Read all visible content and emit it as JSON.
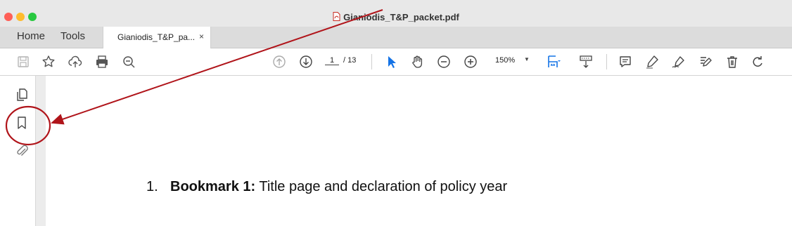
{
  "window": {
    "file_title": "Gianiodis_T&P_packet.pdf",
    "traffic_lights": {
      "close": "#ff5f57",
      "minimize": "#febc2e",
      "zoom": "#28c840"
    }
  },
  "menu": {
    "home_label": "Home",
    "tools_label": "Tools"
  },
  "document_tab": {
    "label": "Gianiodis_T&P_pa...",
    "close_glyph": "×"
  },
  "toolbar": {
    "page_current": "1",
    "page_total": "/ 13",
    "zoom_value": "150%",
    "zoom_caret": "▼",
    "accent_color": "#1473e6",
    "icons": [
      "save-icon",
      "star-icon",
      "upload-cloud-icon",
      "print-icon",
      "zoom-search-icon",
      "prev-page-icon",
      "next-page-icon",
      "select-cursor-icon",
      "hand-icon",
      "zoom-out-icon",
      "zoom-in-icon",
      "fit-page-icon",
      "scroll-mode-icon",
      "comment-icon",
      "highlight-icon",
      "sign-icon",
      "edit-icon",
      "delete-icon",
      "rotate-icon"
    ]
  },
  "left_rail": {
    "icons": [
      "pages-icon",
      "bookmark-icon",
      "attachment-icon"
    ]
  },
  "document": {
    "item_number": "1.",
    "item_bold": "Bookmark 1:",
    "item_text": " Title page and declaration of policy year"
  },
  "annotation": {
    "color": "#b0141a"
  }
}
